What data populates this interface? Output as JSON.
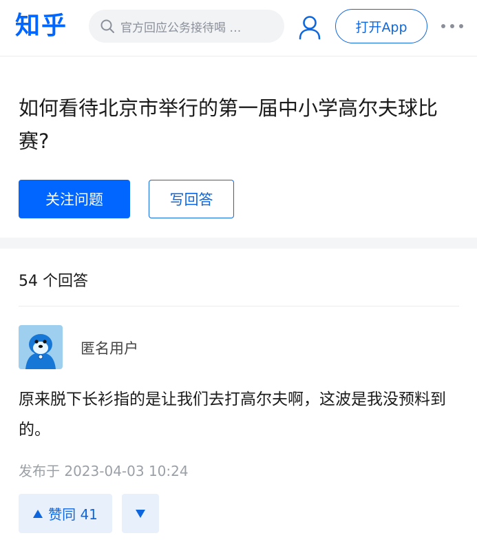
{
  "header": {
    "logo": "知乎",
    "search_placeholder": "官方回应公务接待喝 …",
    "open_app_label": "打开App"
  },
  "question": {
    "title": "如何看待北京市举行的第一届中小学高尔夫球比赛?",
    "follow_label": "关注问题",
    "write_answer_label": "写回答"
  },
  "answers": {
    "count_label": "54 个回答",
    "items": [
      {
        "author": "匿名用户",
        "content": "原来脱下长衫指的是让我们去打高尔夫啊，这波是我没预料到的。",
        "published": "发布于 2023-04-03 10:24",
        "upvote_label": "赞同 41"
      }
    ]
  },
  "colors": {
    "brand": "#0066ff",
    "accent_text": "#0d66dd",
    "vote_bg": "#e8f0fc",
    "meta_text": "#9aa0a6"
  },
  "icons": {
    "search": "search-icon",
    "user": "user-icon",
    "more": "more-dots-icon",
    "upvote": "triangle-up-icon",
    "downvote": "triangle-down-icon",
    "avatar": "anonymous-avatar-icon"
  }
}
